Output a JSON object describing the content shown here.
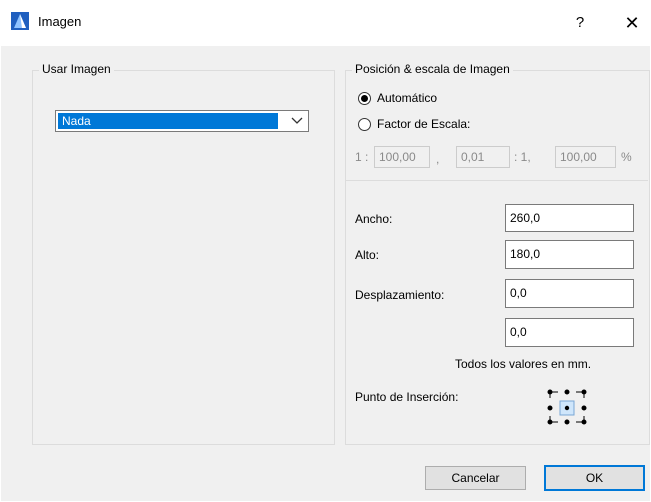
{
  "window": {
    "title": "Imagen",
    "help": "?",
    "close": "✕"
  },
  "left_group": {
    "title": "Usar Imagen",
    "combo_value": "Nada"
  },
  "right_group": {
    "title": "Posición & escala de Imagen",
    "radio_auto": "Automático",
    "radio_scale": "Factor de Escala:",
    "scale": {
      "prefix": "1 :",
      "value1": "100,00",
      "sep1": ",",
      "value2": "0,01",
      "sep2": ": 1,",
      "value3": "100,00",
      "unit": "%"
    }
  },
  "dims": {
    "width_label": "Ancho:",
    "width_value": "260,0",
    "height_label": "Alto:",
    "height_value": "180,0",
    "offset_label": "Desplazamiento:",
    "offset_x": "0,0",
    "offset_y": "0,0",
    "units_note": "Todos los valores en mm.",
    "insertion_label": "Punto de Inserción:"
  },
  "buttons": {
    "cancel": "Cancelar",
    "ok": "OK"
  }
}
